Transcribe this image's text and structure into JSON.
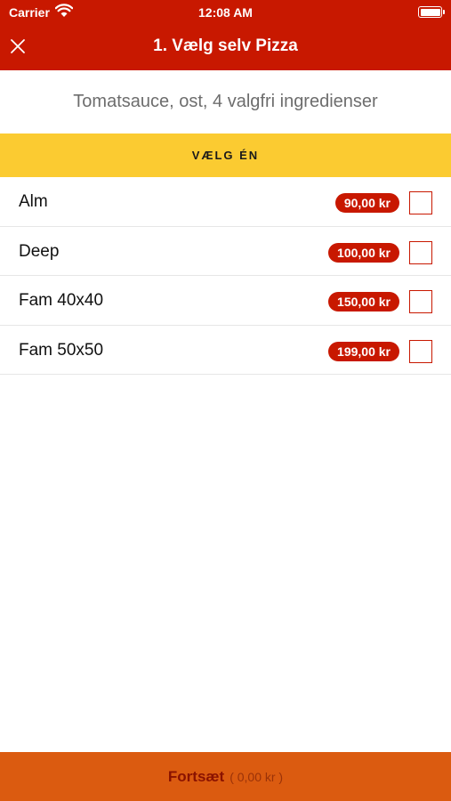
{
  "status_bar": {
    "carrier": "Carrier",
    "time": "12:08 AM"
  },
  "navbar": {
    "title": "1. Vælg selv Pizza",
    "close_icon": "close-icon"
  },
  "description": "Tomatsauce, ost, 4 valgfri ingredienser",
  "section": {
    "header": "VÆLG ÉN"
  },
  "options": [
    {
      "label": "Alm",
      "price": "90,00 kr",
      "checked": false
    },
    {
      "label": "Deep",
      "price": "100,00 kr",
      "checked": false
    },
    {
      "label": "Fam 40x40",
      "price": "150,00 kr",
      "checked": false
    },
    {
      "label": "Fam 50x50",
      "price": "199,00 kr",
      "checked": false
    }
  ],
  "bottom_bar": {
    "cta": "Fortsæt",
    "total": "( 0,00 kr )"
  },
  "colors": {
    "primary_red": "#c81800",
    "section_yellow": "#fbcb31",
    "cta_orange": "#db5b10"
  }
}
